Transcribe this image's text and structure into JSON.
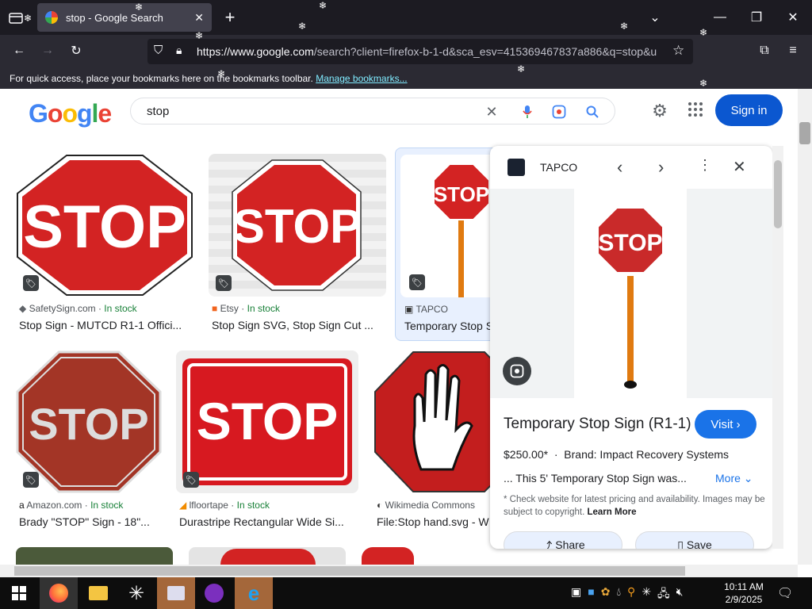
{
  "browser": {
    "tab_title": "stop - Google Search",
    "url_prefix": "https://www.google.com",
    "url_rest": "/search?client=firefox-b-1-d&sca_esv=415369467837a886&q=stop&u",
    "bookmark_text": "For quick access, place your bookmarks here on the bookmarks toolbar.",
    "bookmark_link": "Manage bookmarks..."
  },
  "google": {
    "logo": "Google",
    "query": "stop",
    "signin": "Sign in"
  },
  "results": [
    {
      "source": "SafetySign.com",
      "stock": "In stock",
      "title": "Stop Sign - MUTCD R1-1 Offici..."
    },
    {
      "source": "Etsy",
      "stock": "In stock",
      "title": "Stop Sign SVG, Stop Sign Cut ..."
    },
    {
      "source": "TAPCO",
      "stock": "",
      "title": "Temporary Stop S"
    },
    {
      "source": "Amazon.com",
      "stock": "In stock",
      "title": "Brady \"STOP\" Sign - 18\"..."
    },
    {
      "source": "lfloortape",
      "stock": "In stock",
      "title": "Durastripe Rectangular Wide Si..."
    },
    {
      "source": "Wikimedia Commons",
      "stock": "",
      "title": "File:Stop hand.svg - W"
    }
  ],
  "sign_text": "STOP",
  "panel": {
    "source": "TAPCO",
    "title": "Temporary Stop Sign (R1-1)",
    "visit": "Visit",
    "price": "$250.00*",
    "brand": "Brand: Impact Recovery Systems",
    "desc": "... This 5' Temporary Stop Sign was...",
    "more": "More",
    "note": "* Check website for latest pricing and availability. Images may be subject to copyright.",
    "learn": "Learn More",
    "share": "Share",
    "save": "Save"
  },
  "taskbar": {
    "time": "10:11 AM",
    "date": "2/9/2025"
  },
  "colors": {
    "stop_red": "#d32323",
    "brand_blue": "#0b57d0",
    "stock_green": "#188038"
  }
}
